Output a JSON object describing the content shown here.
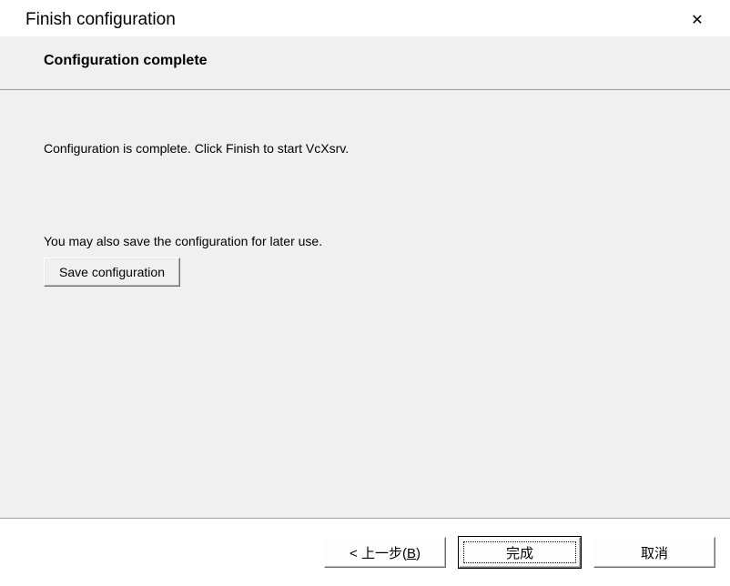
{
  "titlebar": {
    "title": "Finish configuration"
  },
  "subheader": {
    "heading": "Configuration complete"
  },
  "content": {
    "message1": "Configuration is complete. Click Finish to start VcXsrv.",
    "message2": "You may also save the configuration for later use.",
    "save_button_label": "Save configuration"
  },
  "footer": {
    "back_prefix": "< 上一步(",
    "back_mnemonic": "B",
    "back_suffix": ")",
    "finish_label": "完成",
    "cancel_label": "取消"
  }
}
